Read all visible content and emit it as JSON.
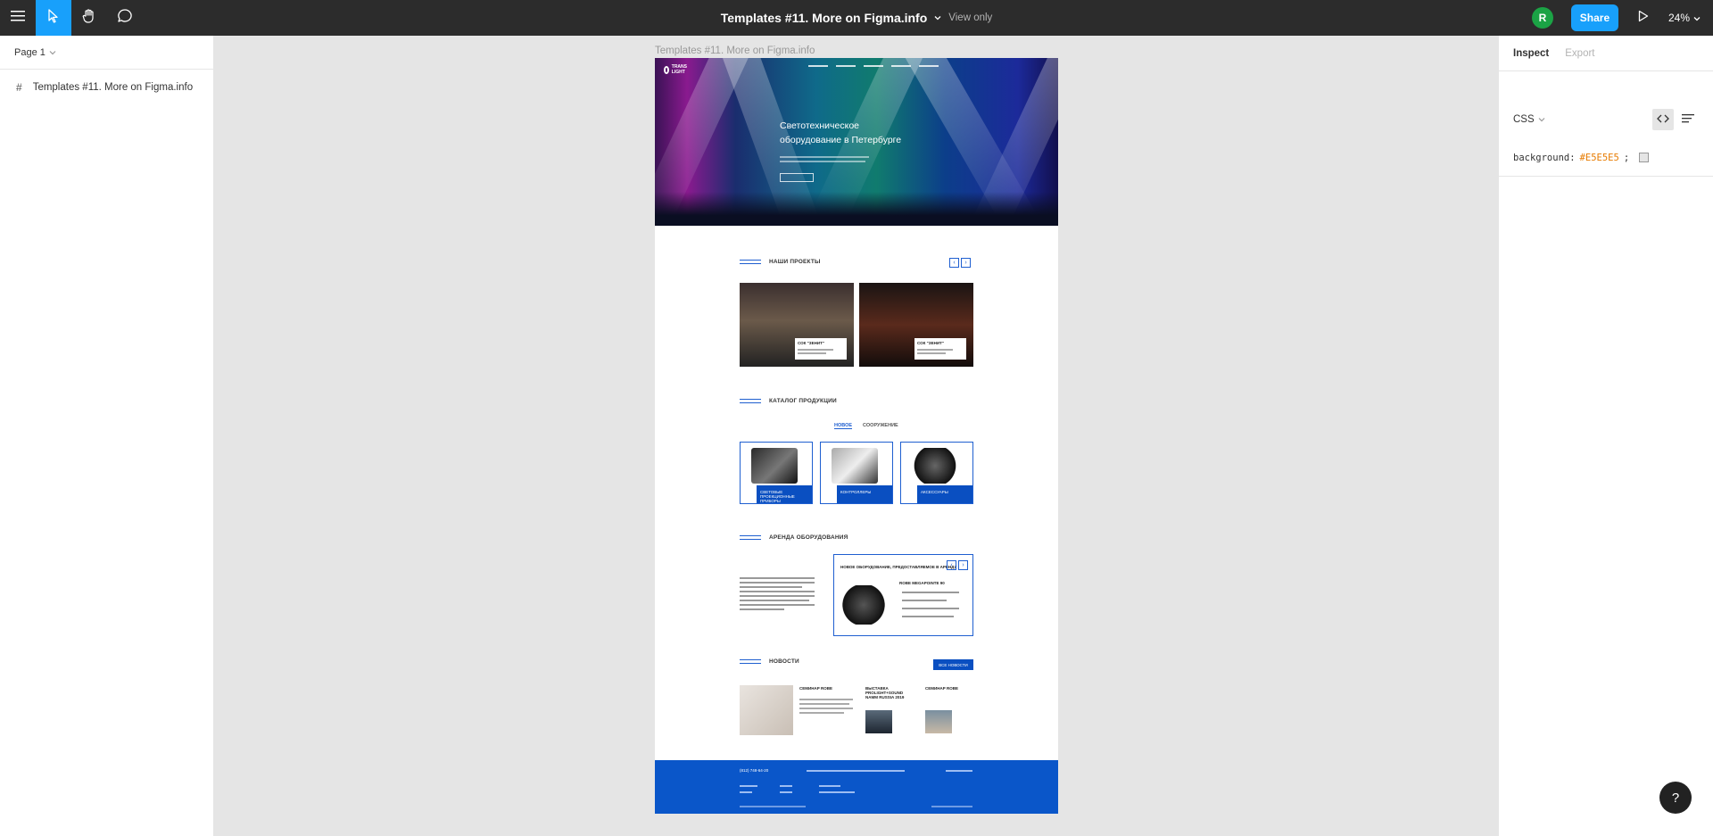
{
  "toolbar": {
    "file_title": "Templates #11. More on Figma.info",
    "view_mode": "View only",
    "avatar_initial": "R",
    "share_label": "Share",
    "zoom_level": "24%"
  },
  "left_panel": {
    "page_selector": "Page 1",
    "layers": [
      {
        "label": "Templates #11. More on Figma.info"
      }
    ]
  },
  "right_panel": {
    "tabs": [
      "Inspect",
      "Export"
    ],
    "code_language": "CSS",
    "code_property": "background:",
    "code_value": "#E5E5E5",
    "code_terminator": ";"
  },
  "canvas": {
    "frame_label": "Templates #11. More on Figma.info",
    "hero_title": "Светотехническое оборудование в Петербурге",
    "section_titles": [
      "НАШИ ПРОЕКТЫ",
      "КАТАЛОГ ПРОДУКЦИИ",
      "АРЕНДА ОБОРУДОВАНИЯ",
      "НОВОСТИ"
    ],
    "projects": [
      "СОК \"ЗЕНИТ\"",
      "СОК \"ЗЕНИТ\""
    ],
    "catalog_tabs": [
      "НОВОЕ",
      "СООРУЖЕНИЕ"
    ],
    "catalog_items": [
      "СВЕТОВЫЕ ПРОЕКЦИОННЫЕ ПРИБОРЫ",
      "КОНТРОЛЛЕРЫ",
      "АКСЕССУАРЫ"
    ],
    "rent_header": "НОВОЕ ОБОРУДОВАНИЕ, ПРЕДОСТАВЛЯЕМОЕ В АРЕНДУ",
    "rent_item": "ROBE MEGAPOINTE 90",
    "news_button": "ВСЕ НОВОСТИ",
    "news": [
      "СЕМИНАР ROBE",
      "ВЫСТАВКА PROLIGHT+SOUND NAMM RUSSIA 2019",
      "СЕМИНАР ROBE"
    ],
    "footer_phone": "(812) 748-64-20"
  },
  "colors": {
    "accent": "#18a0fb",
    "toolbar_bg": "#2c2c2c",
    "canvas_bg": "#e5e5e5",
    "site_blue": "#0a56c9"
  }
}
